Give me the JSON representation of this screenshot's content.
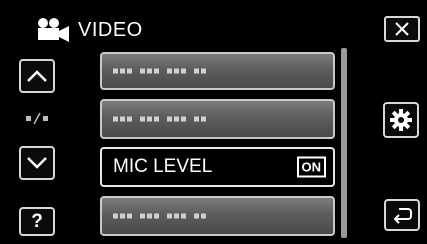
{
  "header": {
    "title": "VIDEO",
    "icon": "video-camera-icon"
  },
  "buttons": {
    "close_icon": "close-icon",
    "up_icon": "chevron-up-icon",
    "down_icon": "chevron-down-icon",
    "help_label": "?",
    "settings_icon": "gear-icon",
    "back_icon": "back-arrow-icon"
  },
  "page_indicator": {
    "icon": "page-indicator-icon"
  },
  "menu": {
    "items": [
      {
        "label": "",
        "placeholder_dots": true
      },
      {
        "label": "",
        "placeholder_dots": true
      },
      {
        "label": "MIC LEVEL",
        "badge": "ON"
      },
      {
        "label": "",
        "placeholder_dots": true
      }
    ]
  },
  "colors": {
    "background": "#000000",
    "border": "#d8d8d8",
    "item_gradient_top": "#7c7c7c",
    "item_gradient_bottom": "#4a4a4a"
  }
}
